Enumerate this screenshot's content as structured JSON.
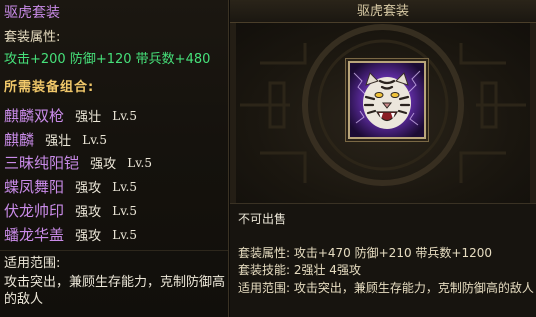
{
  "left_panel": {
    "set_title": "驱虎套装",
    "attribute_label": "套装属性:",
    "attribute_values": "攻击+200 防御+120 带兵数+480",
    "required_label": "所需装备组合:",
    "equipment": [
      {
        "name": "麒麟双枪",
        "type": "强壮",
        "level": "Lv.5"
      },
      {
        "name": "麒麟",
        "type": "强壮",
        "level": "Lv.5"
      },
      {
        "name": "三昧纯阳铠",
        "type": "强攻",
        "level": "Lv.5"
      },
      {
        "name": "蝶凤舞阳",
        "type": "强攻",
        "level": "Lv.5"
      },
      {
        "name": "伏龙帅印",
        "type": "强攻",
        "level": "Lv.5"
      },
      {
        "name": "蟠龙华盖",
        "type": "强攻",
        "level": "Lv.5"
      }
    ],
    "scope_label": "适用范围:",
    "scope_text": "攻击突出，兼顾生存能力，克制防御高的敌人"
  },
  "right_panel": {
    "title": "驱虎套装",
    "icon": "tiger-head-icon",
    "not_sellable": "不可出售",
    "attribute_line": "套装属性: 攻击+470 防御+210 带兵数+1200",
    "skill_line": "套装技能: 2强壮  4强攻",
    "scope_line": "适用范围: 攻击突出，兼顾生存能力，克制防御高的敌人"
  },
  "colors": {
    "purple_name": "#c98be8",
    "green_value": "#46e07a",
    "gold_header": "#f1c86a",
    "cream_text": "#e6dcc0"
  }
}
